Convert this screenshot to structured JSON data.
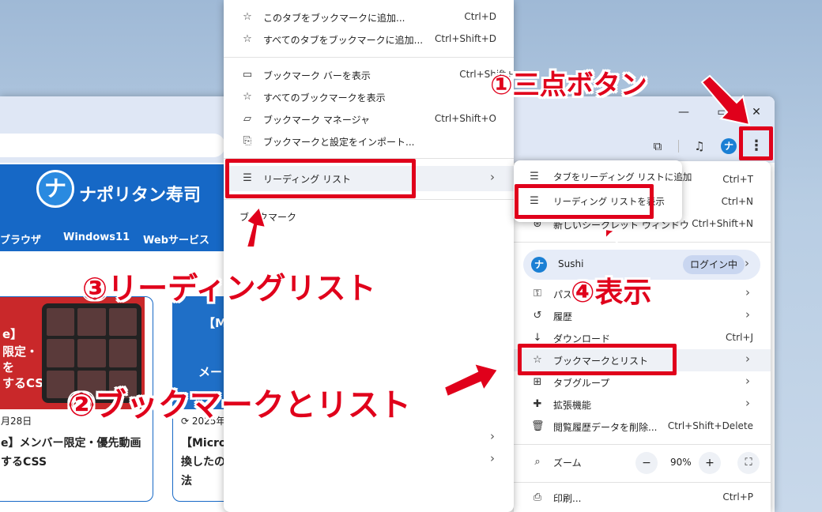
{
  "colors": {
    "accent_red": "#e0001b",
    "site_blue": "#1668c6"
  },
  "window": {
    "minimize": "—",
    "maximize": "▭",
    "close": "✕"
  },
  "toolbar": {
    "extensions_icon": "puzzle-icon",
    "media_icon": "music-list-icon",
    "menu_icon": "three-dots-icon",
    "avatar_glyph": "ナ",
    "menu_glyph": "⋮"
  },
  "site": {
    "logo_glyph": "ナ",
    "name": "ナポリタン寿司",
    "nav": [
      "ブラウザ",
      "Windows11",
      "Webサービス"
    ],
    "cards": [
      {
        "thumb_lines": [
          "e】",
          "限定・",
          "を",
          "するCSS"
        ],
        "date": "月28日",
        "title_lines": [
          "e】メンバー限定・優先動画",
          "するCSS"
        ]
      },
      {
        "thumb_lines": [
          "【M",
          "メー"
        ],
        "date": "2025年",
        "title_lines": [
          "【Micros",
          "換したの",
          "法"
        ]
      }
    ]
  },
  "bookmark_menu": {
    "items": [
      {
        "icon": "star-icon",
        "glyph": "☆",
        "label": "このタブをブックマークに追加...",
        "shortcut": "Ctrl+D"
      },
      {
        "icon": "star-all-icon",
        "glyph": "☆",
        "label": "すべてのタブをブックマークに追加...",
        "shortcut": "Ctrl+Shift+D"
      },
      {
        "icon": "bookmark-bar-icon",
        "glyph": "▭",
        "label": "ブックマーク バーを表示",
        "shortcut": "Ctrl+Shift+"
      },
      {
        "icon": "bookmarks-icon",
        "glyph": "☆",
        "label": "すべてのブックマークを表示",
        "shortcut": ""
      },
      {
        "icon": "folder-icon",
        "glyph": "▱",
        "label": "ブックマーク マネージャ",
        "shortcut": "Ctrl+Shift+O"
      },
      {
        "icon": "import-icon",
        "glyph": "⎘",
        "label": "ブックマークと設定をインポート...",
        "shortcut": ""
      },
      {
        "icon": "reading-list-icon",
        "glyph": "☰",
        "label": "リーディング リスト",
        "shortcut": ""
      }
    ],
    "section_label": "ブックマーク",
    "chevron": "›"
  },
  "reading_submenu": {
    "items": [
      {
        "icon": "add-to-list-icon",
        "glyph": "☰",
        "label": "タブをリーディング リストに追加"
      },
      {
        "icon": "list-icon",
        "glyph": "☰",
        "label": "リーディング リストを表示"
      }
    ]
  },
  "chrome_menu": {
    "partial_shortcuts": [
      {
        "shortcut": "Ctrl+T"
      },
      {
        "shortcut": "Ctrl+N"
      }
    ],
    "incognito": {
      "label": "新しいシークレット ウィンドウ",
      "shortcut": "Ctrl+Shift+N",
      "icon": "incognito-icon",
      "glyph": "⊛"
    },
    "profile": {
      "name": "Sushi",
      "status": "ログイン中",
      "avatar_glyph": "ナ"
    },
    "items": [
      {
        "icon": "key-icon",
        "glyph": "⚿",
        "label": "パス",
        "shortcut": "",
        "chevron": true
      },
      {
        "icon": "history-icon",
        "glyph": "↺",
        "label": "履歴",
        "shortcut": "",
        "chevron": true
      },
      {
        "icon": "download-icon",
        "glyph": "↓",
        "label": "ダウンロード",
        "shortcut": "Ctrl+J",
        "chevron": false
      },
      {
        "icon": "star-icon",
        "glyph": "☆",
        "label": "ブックマークとリスト",
        "shortcut": "",
        "chevron": true
      },
      {
        "icon": "tab-groups-icon",
        "glyph": "⊞",
        "label": "タブグループ",
        "shortcut": "",
        "chevron": true
      },
      {
        "icon": "extensions-icon",
        "glyph": "✚",
        "label": "拡張機能",
        "shortcut": "",
        "chevron": true
      },
      {
        "icon": "trash-icon",
        "glyph": "🗑",
        "label": "閲覧履歴データを削除...",
        "shortcut": "Ctrl+Shift+Delete",
        "chevron": false
      }
    ],
    "zoom": {
      "label": "ズーム",
      "minus": "−",
      "value": "90%",
      "plus": "+",
      "fullscreen": "⛶",
      "icon_glyph": "⌕"
    },
    "print": {
      "label": "印刷...",
      "shortcut": "Ctrl+P",
      "glyph": "⎙"
    },
    "chevron": "›"
  },
  "callouts": {
    "step1": "①三点ボタン",
    "step2": "②ブックマークとリスト",
    "step3": "③リーディングリスト",
    "step4": "④表示"
  }
}
